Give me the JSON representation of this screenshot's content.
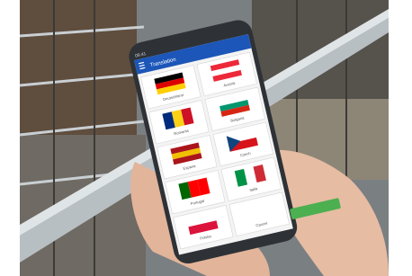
{
  "app": {
    "screen_title": "Translation",
    "status_time": "09:41",
    "colors": {
      "app_bar": "#1c56b8",
      "accent_button": "#4caf50"
    }
  },
  "flags": [
    {
      "name": "germany",
      "label": "Deutschland",
      "icon": "flag-germany"
    },
    {
      "name": "austria",
      "label": "Austria",
      "icon": "flag-austria"
    },
    {
      "name": "romania",
      "label": "Romania",
      "icon": "flag-romania"
    },
    {
      "name": "bulgaria",
      "label": "Bulgaria",
      "icon": "flag-bulgaria"
    },
    {
      "name": "spain",
      "label": "Espana",
      "icon": "flag-spain"
    },
    {
      "name": "czechia",
      "label": "Czech",
      "icon": "flag-czechia"
    },
    {
      "name": "portugal",
      "label": "Portugal",
      "icon": "flag-portugal"
    },
    {
      "name": "italy",
      "label": "Italia",
      "icon": "flag-italy"
    },
    {
      "name": "poland",
      "label": "Polska",
      "icon": "flag-poland"
    },
    {
      "name": "cancel",
      "label": "Cancel",
      "icon": "button"
    }
  ]
}
